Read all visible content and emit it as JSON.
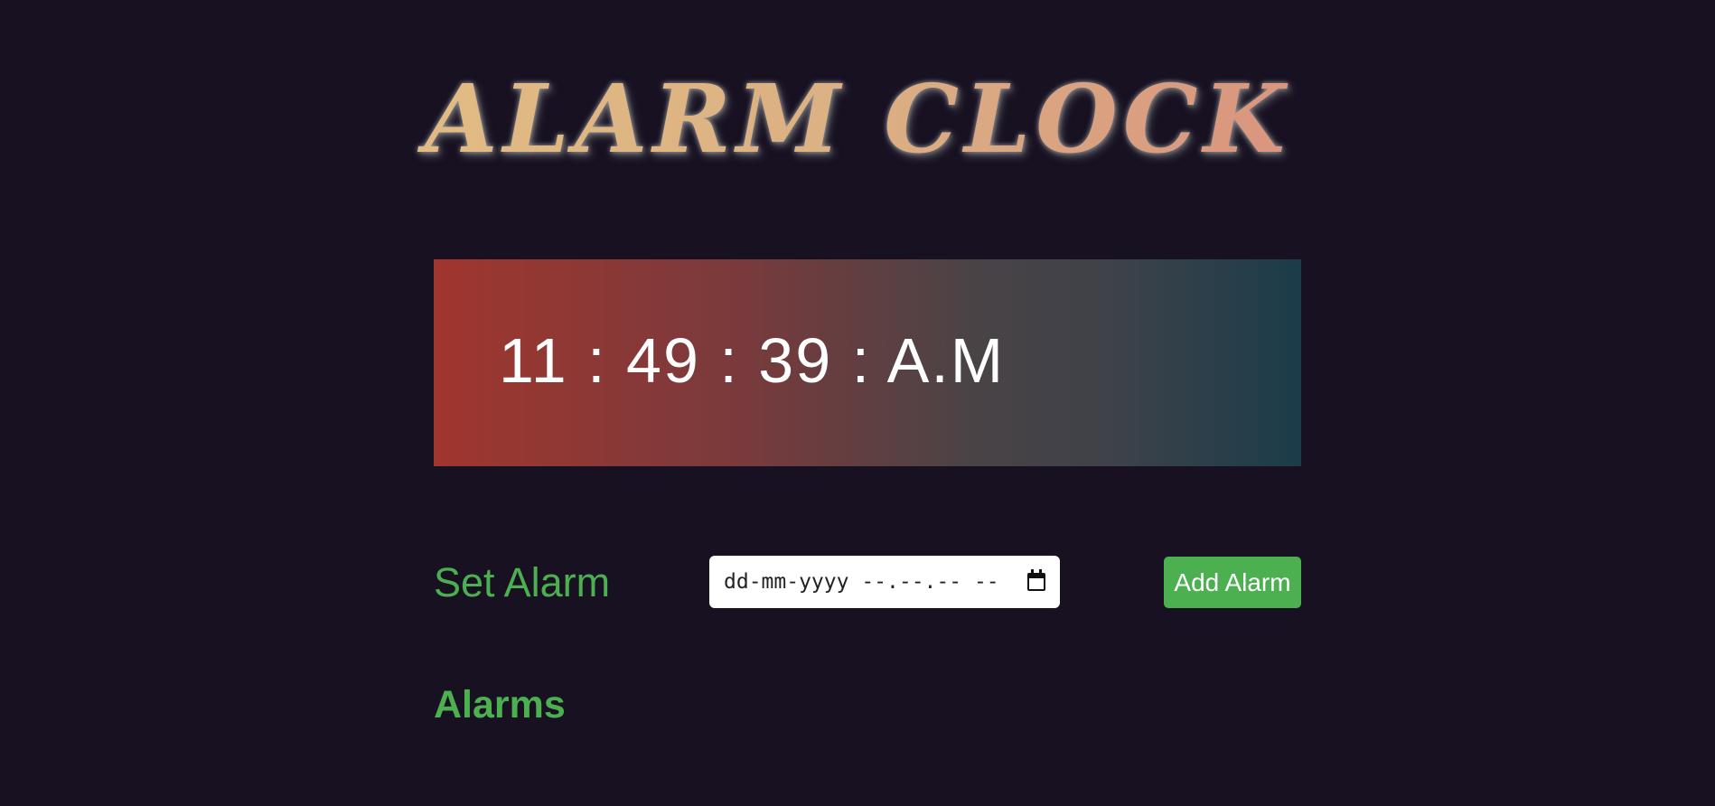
{
  "app": {
    "title": "ALARM CLOCK"
  },
  "clock": {
    "hours": "11",
    "minutes": "49",
    "seconds": "39",
    "period": "A.M",
    "separator": " : "
  },
  "alarm_form": {
    "label": "Set Alarm",
    "input_value": "dd-mm-yyyy --.--.-- --",
    "input_icon": "calendar-icon",
    "add_button_label": "Add Alarm"
  },
  "alarms": {
    "heading": "Alarms",
    "items": []
  },
  "colors": {
    "background": "#171122",
    "accent": "#4caf50",
    "clock_gradient_start": "#a0362e",
    "clock_gradient_end": "#1b3c4a",
    "title_gradient_start": "#e8c584",
    "title_gradient_end": "#d87a7a"
  }
}
